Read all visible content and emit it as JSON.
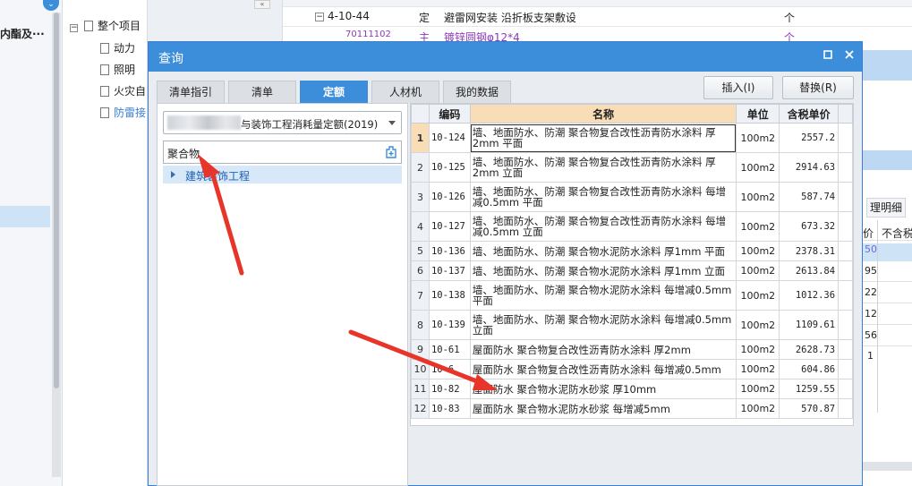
{
  "background": {
    "left_text": "内酯及···",
    "tree": {
      "root_label": "整个项目",
      "nodes": [
        "动力",
        "照明",
        "火灾自",
        "防雷接"
      ]
    },
    "top_rows": [
      {
        "code": "4-10-44",
        "type": "定",
        "name": "避雷网安装 沿折板支架敷设",
        "unit": "个"
      },
      {
        "code": "70111102",
        "type": "主",
        "name": "镀锌圆钢φ12*4",
        "unit": "个"
      }
    ],
    "right_panel": {
      "tab_label": "理明细",
      "col1": "价",
      "col2": "不含税",
      "values": [
        "50",
        "95",
        "22",
        "12",
        "56",
        "1"
      ]
    }
  },
  "dialog": {
    "title": "查询",
    "tabs": [
      "清单指引",
      "清单",
      "定额",
      "人材机",
      "我的数据"
    ],
    "active_tab": "定额",
    "insert_label": "插入(I)",
    "replace_label": "替换(R)",
    "library_text": "与装饰工程消耗量定额(2019)",
    "search_value": "聚合物",
    "tree_item": "建筑装饰工程",
    "grid": {
      "headers": [
        "编码",
        "名称",
        "单位",
        "含税单价"
      ],
      "rows": [
        {
          "no": "1",
          "code": "10-124",
          "name": "墙、地面防水、防潮 聚合物复合改性沥青防水涂料 厚2mm 平面",
          "unit": "100m2",
          "price": "2557.2"
        },
        {
          "no": "2",
          "code": "10-125",
          "name": "墙、地面防水、防潮 聚合物复合改性沥青防水涂料 厚2mm 立面",
          "unit": "100m2",
          "price": "2914.63"
        },
        {
          "no": "3",
          "code": "10-126",
          "name": "墙、地面防水、防潮 聚合物复合改性沥青防水涂料 每增减0.5mm 平面",
          "unit": "100m2",
          "price": "587.74"
        },
        {
          "no": "4",
          "code": "10-127",
          "name": "墙、地面防水、防潮 聚合物复合改性沥青防水涂料 每增减0.5mm 立面",
          "unit": "100m2",
          "price": "673.32"
        },
        {
          "no": "5",
          "code": "10-136",
          "name": "墙、地面防水、防潮 聚合物水泥防水涂料 厚1mm 平面",
          "unit": "100m2",
          "price": "2378.31"
        },
        {
          "no": "6",
          "code": "10-137",
          "name": "墙、地面防水、防潮 聚合物水泥防水涂料 厚1mm 立面",
          "unit": "100m2",
          "price": "2613.84"
        },
        {
          "no": "7",
          "code": "10-138",
          "name": "墙、地面防水、防潮 聚合物水泥防水涂料 每增减0.5mm 平面",
          "unit": "100m2",
          "price": "1012.36"
        },
        {
          "no": "8",
          "code": "10-139",
          "name": "墙、地面防水、防潮 聚合物水泥防水涂料 每增减0.5mm 立面",
          "unit": "100m2",
          "price": "1109.61"
        },
        {
          "no": "9",
          "code": "10-61",
          "name": "屋面防水 聚合物复合改性沥青防水涂料 厚2mm",
          "unit": "100m2",
          "price": "2628.73"
        },
        {
          "no": "10",
          "code": "10-6",
          "name": "屋面防水 聚合物复合改性沥青防水涂料 每增减0.5mm",
          "unit": "100m2",
          "price": "604.86"
        },
        {
          "no": "11",
          "code": "10-82",
          "name": "屋面防水 聚合物水泥防水砂浆 厚10mm",
          "unit": "100m2",
          "price": "1259.55"
        },
        {
          "no": "12",
          "code": "10-83",
          "name": "屋面防水 聚合物水泥防水砂浆 每增减5mm",
          "unit": "100m2",
          "price": "570.87"
        }
      ]
    }
  },
  "colors": {
    "accent": "#3c8edb",
    "header_highlight": "#f9ddb6",
    "annotation_arrow": "#e8352a"
  }
}
